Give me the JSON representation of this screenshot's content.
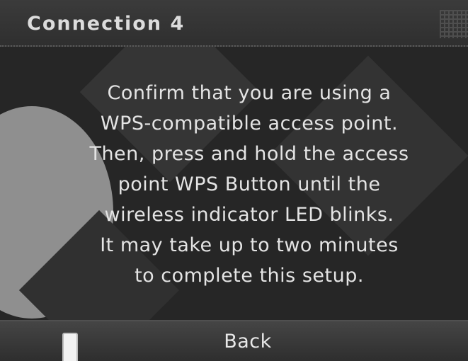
{
  "title_bar": {
    "title": "Connection 4"
  },
  "message": {
    "lines": [
      "Confirm that you are using a",
      "WPS-compatible access point.",
      "Then, press and hold the access",
      "point WPS Button until the",
      "wireless indicator LED blinks.",
      "It may take up to two minutes",
      "to complete this setup."
    ]
  },
  "bottom_bar": {
    "back_label": "Back"
  },
  "icons": {
    "title_corner": "grid-pattern-icon",
    "scroll": "scroll-handle-icon"
  }
}
